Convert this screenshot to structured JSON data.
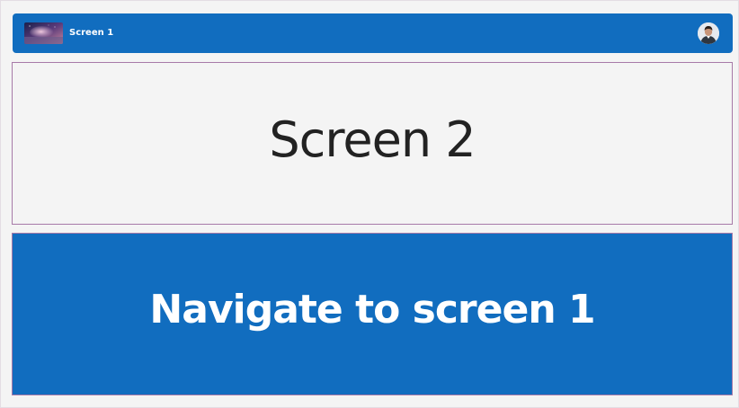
{
  "header": {
    "title": "Screen 1",
    "thumbnail_icon": "galaxy-thumbnail-image",
    "avatar_icon": "user-avatar-icon"
  },
  "main": {
    "screen_label": "Screen 2",
    "nav_button_label": "Navigate to screen 1"
  },
  "colors": {
    "primary": "#116dbf",
    "background": "#f4f4f4",
    "border_accent": "#a77aa8",
    "text_dark": "#222222",
    "text_light": "#ffffff"
  }
}
